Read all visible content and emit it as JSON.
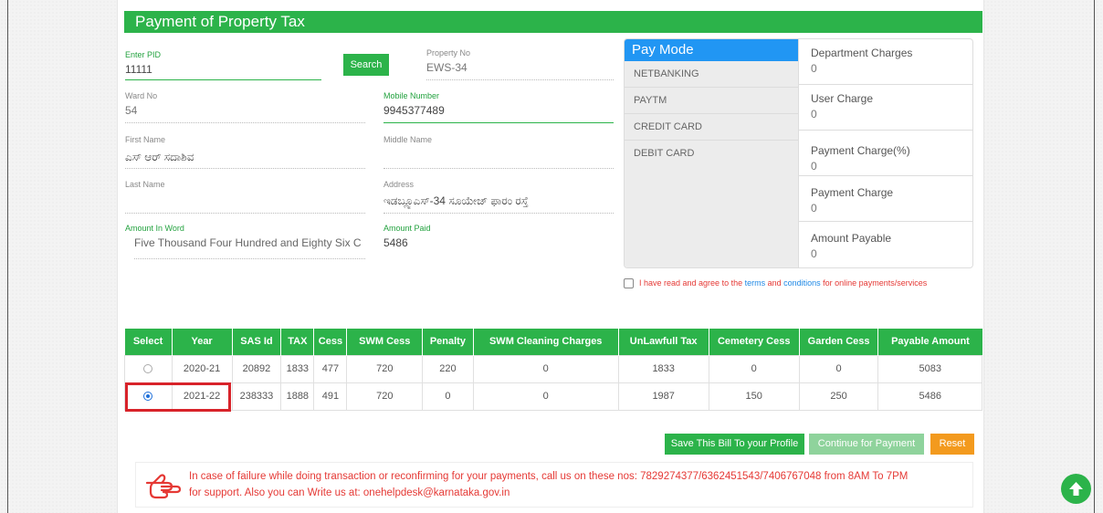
{
  "title": "Payment of Property Tax",
  "form": {
    "pid": {
      "label": "Enter PID",
      "value": "11111"
    },
    "search_label": "Search",
    "property_no": {
      "label": "Property No",
      "value": "EWS-34"
    },
    "ward_no": {
      "label": "Ward No",
      "value": "54"
    },
    "mobile": {
      "label": "Mobile Number",
      "value": "9945377489"
    },
    "first_name": {
      "label": "First Name",
      "value": "ಎಸ್ ಆರ್ ಸದಾಶಿವ"
    },
    "middle_name": {
      "label": "Middle Name",
      "value": ""
    },
    "last_name": {
      "label": "Last Name",
      "value": ""
    },
    "address": {
      "label": "Address",
      "value": "ಇಡಬ್ಲ್ಯೂಎಸ್-34 ಸೂಯೇಜ್ ಫಾರಂ ರಸ್ತೆ"
    },
    "amount_word": {
      "label": "Amount In Word",
      "value": "Five Thousand Four Hundred and Eighty Six C"
    },
    "amount_paid": {
      "label": "Amount Paid",
      "value": "5486"
    }
  },
  "paymode": {
    "heading": "Pay Mode",
    "options": [
      "NETBANKING",
      "PAYTM",
      "CREDIT CARD",
      "DEBIT CARD"
    ]
  },
  "charges": [
    {
      "label": "Department Charges",
      "value": "0"
    },
    {
      "label": "User Charge",
      "value": "0"
    },
    {
      "label": "Payment Charge(%)",
      "value": "0"
    },
    {
      "label": "Payment Charge",
      "value": "0"
    },
    {
      "label": "Amount Payable",
      "value": "0"
    }
  ],
  "terms": {
    "prefix": "I have read and agree to the ",
    "link1": "terms",
    "and": " and ",
    "link2": "conditions",
    "suffix": " for online payments/services",
    "checked": false
  },
  "table": {
    "headers": [
      "Select",
      "Year",
      "SAS Id",
      "TAX",
      "Cess",
      "SWM Cess",
      "Penalty",
      "SWM Cleaning Charges",
      "UnLawfull Tax",
      "Cemetery Cess",
      "Garden Cess",
      "Payable Amount"
    ],
    "rows": [
      {
        "selected": false,
        "cells": [
          "2020-21",
          "20892",
          "1833",
          "477",
          "720",
          "220",
          "0",
          "1833",
          "0",
          "0",
          "5083"
        ]
      },
      {
        "selected": true,
        "cells": [
          "2021-22",
          "238333",
          "1888",
          "491",
          "720",
          "0",
          "0",
          "1987",
          "150",
          "250",
          "5486"
        ]
      }
    ]
  },
  "buttons": {
    "save": "Save This Bill To your Profile",
    "continue": "Continue for Payment",
    "reset": "Reset"
  },
  "notice": {
    "line1": "In case of failure while doing transaction or reconfirming for your payments, call us on these nos: 7829274377/6362451543/7406767048 from 8AM To 7PM",
    "line2": "for support. Also you can Write us at: onehelpdesk@karnataka.gov.in"
  },
  "colors": {
    "primary_green": "#2cb34a",
    "paymode_blue": "#2196f3",
    "alert_red": "#e53935",
    "reset_orange": "#f39a1e"
  }
}
